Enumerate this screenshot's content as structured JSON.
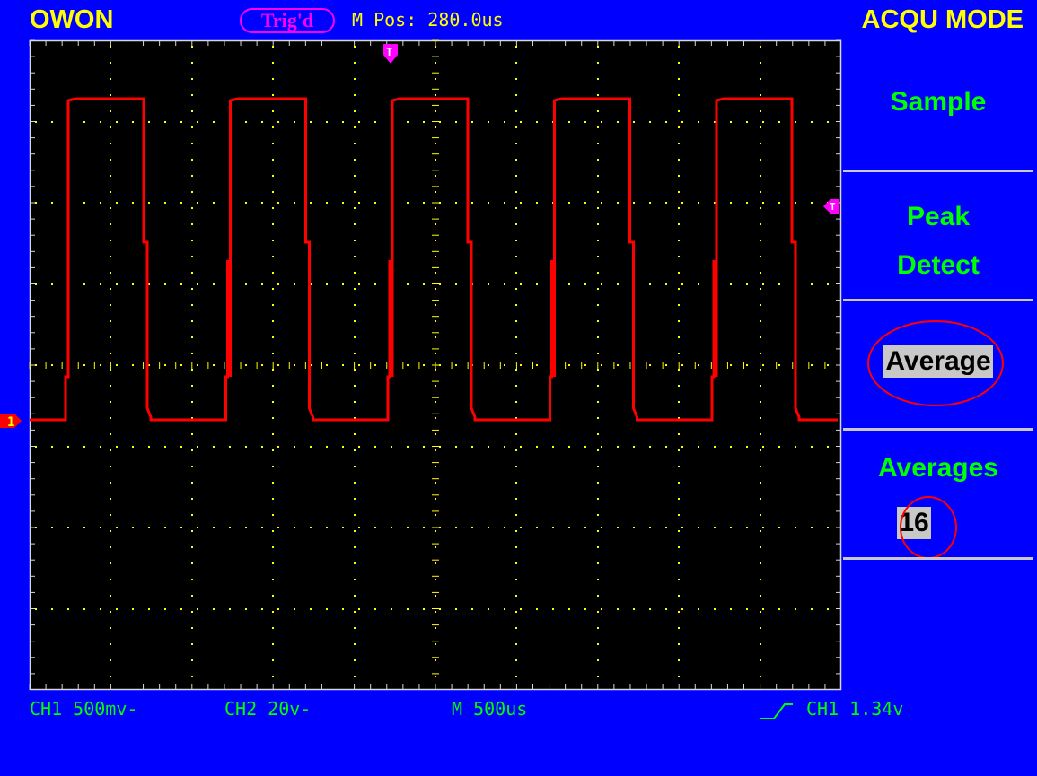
{
  "header": {
    "brand": "OWON",
    "trigger_status": "Trig'd",
    "m_pos": "M Pos: 280.0us",
    "mode_title": "ACQU MODE"
  },
  "menu": {
    "sample": "Sample",
    "peak_detect_line1": "Peak",
    "peak_detect_line2": "Detect",
    "average": "Average",
    "averages_label": "Averages",
    "averages_value": "16",
    "selected": "average"
  },
  "status_bar": {
    "ch1_scale": "CH1 500mv-",
    "ch2_scale": "CH2 20v-",
    "timebase": "M 500us",
    "trigger_info": "CH1 1.34v"
  },
  "markers": {
    "channel": "1",
    "trigger_position": "T",
    "trigger_level": "T"
  },
  "colors": {
    "background": "#0000ff",
    "screen": "#000000",
    "trace": "#ff0000",
    "grid": "#ffff00",
    "menu_text": "#00ff00",
    "header_text": "#ffff00",
    "marker": "#ff00ff"
  },
  "waveform": {
    "type": "square",
    "cycles_visible": 5,
    "channel": "CH1"
  }
}
